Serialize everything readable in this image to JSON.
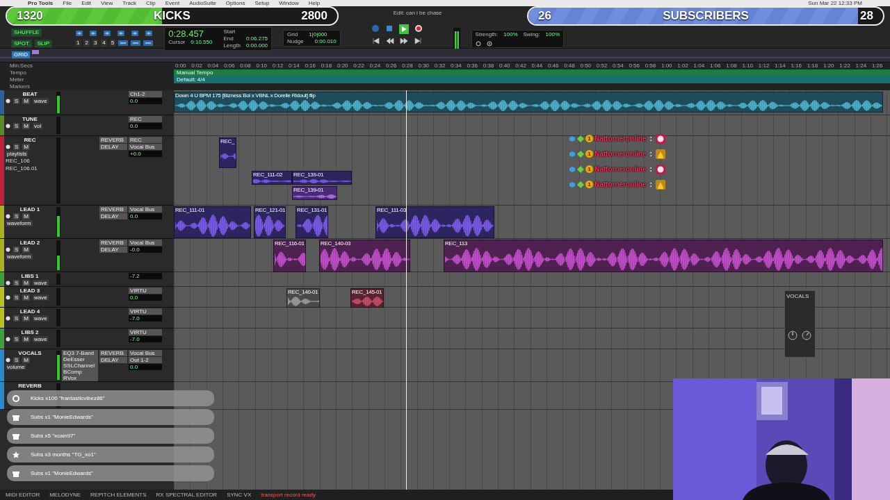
{
  "menu_bar": {
    "items": [
      "Pro Tools",
      "File",
      "Edit",
      "View",
      "Track",
      "Clip",
      "Event",
      "AudioSuite",
      "Options",
      "Setup",
      "Window",
      "Help"
    ],
    "clock": "Sun Mar 22  12:33 PM"
  },
  "goals": [
    {
      "current": "1320",
      "label": "KICKS",
      "target": "2800",
      "level": 0.47,
      "kind": "green"
    },
    {
      "current": "26",
      "label": "SUBSCRIBERS",
      "target": "28",
      "level": 0.93,
      "kind": "blue"
    }
  ],
  "toolbar": {
    "modes": [
      {
        "label": "SHUFFLE",
        "selected": false
      },
      {
        "label": "SPOT",
        "selected": false
      },
      {
        "label": "SLIP",
        "selected": false
      },
      {
        "label": "GRID",
        "selected": true
      }
    ],
    "zoom_presets": [
      "1",
      "2",
      "3",
      "4",
      "5"
    ],
    "counter": "0:28.457",
    "cursor_label": "Cursor",
    "cursor_value": "0:10.550",
    "selection": [
      {
        "label": "Start"
      },
      {
        "label": "End",
        "value": "0:06.275"
      },
      {
        "label": "Length",
        "value": "0:00.000"
      }
    ],
    "grid_label": "Grid",
    "grid_value": "1|0|000",
    "nudge_label": "Nudge",
    "nudge_value": "0:00.010",
    "edit_title": "Edit: can i be chase",
    "strength_label": "Strength:",
    "strength_value": "100%",
    "swing_label": "Swing:",
    "swing_value": "100%"
  },
  "rulers": {
    "labels": [
      "Min:Secs",
      "Tempo",
      "Meter",
      "Markers"
    ],
    "tempo": "Manual Tempo",
    "meter": "Default: 4/4",
    "ticks": [
      "0:00",
      "0:02",
      "0:04",
      "0:06",
      "0:08",
      "0:10",
      "0:12",
      "0:14",
      "0:16",
      "0:18",
      "0:20",
      "0:22",
      "0:24",
      "0:26",
      "0:28",
      "0:30",
      "0:32",
      "0:34",
      "0:36",
      "0:38",
      "0:40",
      "0:42",
      "0:44",
      "0:46",
      "0:48",
      "0:50",
      "0:52",
      "0:54",
      "0:56",
      "0:58",
      "1:00",
      "1:02",
      "1:04",
      "1:06",
      "1:08",
      "1:10",
      "1:12",
      "1:14",
      "1:16",
      "1:18",
      "1:20",
      "1:22",
      "1:24",
      "1:26"
    ]
  },
  "tracks": [
    {
      "name": "BEAT",
      "color": "#2b5f9e",
      "buttons": [
        "S",
        "M"
      ],
      "view": "wave",
      "io": [
        "Ch1-2"
      ],
      "vol": "0.0",
      "level": 0.8,
      "clips": [
        {
          "name": "Down 4 U BPM 175 [Bizness Boi x VBNL x Dorelle Ridout] flip",
          "kind": "teal"
        }
      ]
    },
    {
      "name": "TUNE",
      "color": "#5a8a2a",
      "buttons": [
        "S",
        "M"
      ],
      "view": "vol",
      "io": [
        "REC"
      ],
      "vol": "0.0"
    },
    {
      "name": "REC",
      "color": "#c0203a",
      "buttons": [
        "S",
        "M"
      ],
      "view": "playlists",
      "sends": [
        "REVERB",
        "DELAY"
      ],
      "io": [
        "REC",
        "Vocal Bus"
      ],
      "vol": "+0.0",
      "playlists": [
        "REC_106",
        "REC_106.01"
      ],
      "clips": [
        {
          "name": "REC_",
          "kind": "purple"
        },
        {
          "name": "REC_111-02",
          "kind": "purple"
        },
        {
          "name": "REC_139-01",
          "kind": "purple"
        },
        {
          "name": "REC_139-01",
          "kind": "violet"
        }
      ]
    },
    {
      "name": "LEAD 1",
      "color": "#a8b020",
      "buttons": [
        "S",
        "M"
      ],
      "view": "waveform",
      "sends": [
        "REVERB",
        "DELAY"
      ],
      "io": [
        "Vocal Bus"
      ],
      "vol": "0.0",
      "level": 0.7,
      "clips": [
        {
          "name": "REC_111-01",
          "kind": "purple"
        },
        {
          "name": "REC_121-01",
          "kind": "purple"
        },
        {
          "name": "REC_131-01",
          "kind": "purple"
        },
        {
          "name": "REC_111-03",
          "kind": "purple"
        }
      ]
    },
    {
      "name": "LEAD 2",
      "color": "#a8b020",
      "buttons": [
        "S",
        "M"
      ],
      "view": "waveform",
      "sends": [
        "REVERB",
        "DELAY"
      ],
      "io": [
        "Vocal Bus"
      ],
      "vol": "-0.0",
      "level": 0.5,
      "clips": [
        {
          "name": "REC_116-01",
          "kind": "magenta"
        },
        {
          "name": "REC_140-03",
          "kind": "magenta"
        },
        {
          "name": "REC_113",
          "kind": "magenta"
        }
      ]
    },
    {
      "name": "LIBS 1",
      "color": "#40a040",
      "buttons": [
        "S",
        "M"
      ],
      "view": "wave",
      "vol": "-7.2"
    },
    {
      "name": "LEAD 3",
      "color": "#b8c020",
      "buttons": [
        "S",
        "M"
      ],
      "view": "wave",
      "io": [
        "VIRTU"
      ],
      "vol": "0.0",
      "clips": [
        {
          "name": "REC_140-01",
          "kind": "grey"
        },
        {
          "name": "REC_145-01",
          "kind": "red"
        }
      ]
    },
    {
      "name": "LEAD 4",
      "color": "#b8c020",
      "buttons": [
        "S",
        "M"
      ],
      "view": "wave",
      "io": [
        "VIRTU"
      ],
      "vol": "-7.0"
    },
    {
      "name": "LIBS 2",
      "color": "#40a040",
      "buttons": [
        "S",
        "M"
      ],
      "view": "wave",
      "io": [
        "VIRTU"
      ],
      "vol": "-7.0"
    },
    {
      "name": "VOCALS",
      "color": "#2a8ad0",
      "buttons": [
        "S",
        "M"
      ],
      "view": "volume",
      "sends": [
        "REVERB",
        "DELAY"
      ],
      "inserts": [
        "EQ3 7-Band",
        "DeEsser",
        "SSLChannel",
        "BComp",
        "RVox"
      ],
      "io": [
        "Vocal Bus",
        "Out 1-2"
      ],
      "vol": "0.0",
      "level": 0.85
    },
    {
      "name": "REVERB",
      "color": "#2a8ad0"
    }
  ],
  "chat": [
    {
      "user": "Nattorneronline",
      "tier": "1",
      "separator": ":",
      "kind": "heart"
    },
    {
      "user": "Nattorneronline",
      "tier": "1",
      "separator": ":",
      "kind": "fire"
    },
    {
      "user": "Nattorneronline",
      "tier": "1",
      "separator": ":",
      "kind": "heart"
    },
    {
      "user": "Nattorneronline",
      "tier": "1",
      "separator": ":",
      "kind": "fire"
    }
  ],
  "alerts": [
    {
      "kind": "kick",
      "text": "Kicks x100 \"frantasticvibez86\""
    },
    {
      "kind": "gift",
      "text": "Subs x1 \"MonieEdwards\""
    },
    {
      "kind": "gift",
      "text": "Subs x5 \"xcain97\""
    },
    {
      "kind": "star",
      "text": "Subs x3 months \"TG_xo1\""
    },
    {
      "kind": "gift",
      "text": "Subs x1 \"MonieEdwards\""
    }
  ],
  "mini_window": {
    "title": "VOCALS"
  },
  "bottom_bar": {
    "tabs": [
      "MIDI EDITOR",
      "MELODYNE",
      "REPITCH ELEMENTS",
      "RX SPECTRAL EDITOR",
      "SYNC VX"
    ],
    "status": "transport record ready"
  }
}
